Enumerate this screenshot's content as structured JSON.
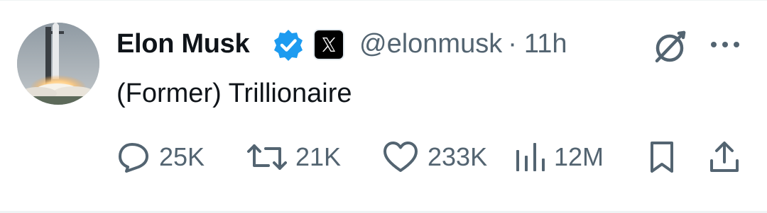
{
  "tweet": {
    "author_name": "Elon Musk",
    "handle": "@elonmusk",
    "separator": "·",
    "time": "11h",
    "text": "(Former) Trillionaire",
    "verified_color": "#1d9bf0",
    "icons": {
      "verified": "verified-badge-icon",
      "affiliate": "x-logo-icon",
      "grok": "grok-icon",
      "more": "more-options-icon"
    }
  },
  "actions": {
    "replies": {
      "icon": "reply-icon",
      "count": "25K"
    },
    "reposts": {
      "icon": "repost-icon",
      "count": "21K"
    },
    "likes": {
      "icon": "heart-icon",
      "count": "233K"
    },
    "views": {
      "icon": "views-chart-icon",
      "count": "12M"
    },
    "bookmark": {
      "icon": "bookmark-icon"
    },
    "share": {
      "icon": "share-icon"
    }
  },
  "colors": {
    "text_primary": "#0f1419",
    "text_secondary": "#536471"
  }
}
